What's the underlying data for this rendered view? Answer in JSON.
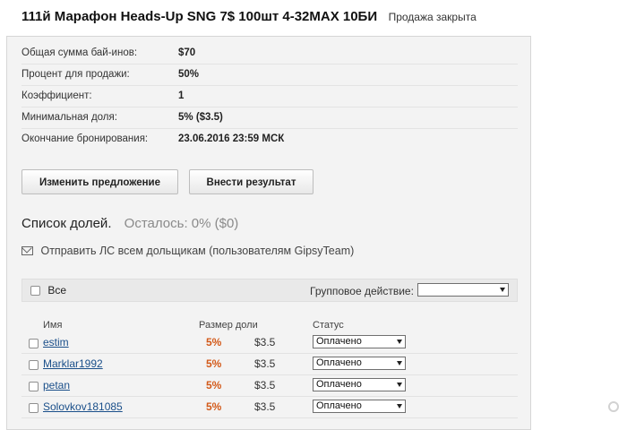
{
  "header": {
    "title": "111й Марафон Heads-Up SNG 7$ 100шт 4-32MAX 10БИ",
    "status": "Продажа закрыта"
  },
  "info": [
    {
      "label": "Общая сумма бай-инов:",
      "value": "$70"
    },
    {
      "label": "Процент для продажи:",
      "value": "50%"
    },
    {
      "label": "Коэффициент:",
      "value": "1"
    },
    {
      "label": "Минимальная доля:",
      "value": "5% ($3.5)"
    },
    {
      "label": "Окончание бронирования:",
      "value": "23.06.2016 23:59 МСК"
    }
  ],
  "buttons": {
    "edit_offer": "Изменить предложение",
    "enter_result": "Внести результат"
  },
  "shares": {
    "title": "Список долей.",
    "remaining": "Осталось: 0% ($0)",
    "send_message": "Отправить ЛС всем дольщикам (пользователям GipsyTeam)",
    "select_all": "Все",
    "group_action_label": "Групповое действие:",
    "group_action_value": ""
  },
  "columns": {
    "name": "Имя",
    "share_size": "Размер доли",
    "status": "Статус"
  },
  "rows": [
    {
      "name": "estim",
      "percent": "5%",
      "amount": "$3.5",
      "status": "Оплачено"
    },
    {
      "name": "Marklar1992",
      "percent": "5%",
      "amount": "$3.5",
      "status": "Оплачено"
    },
    {
      "name": "petan",
      "percent": "5%",
      "amount": "$3.5",
      "status": "Оплачено"
    },
    {
      "name": "Solovkov181085",
      "percent": "5%",
      "amount": "$3.5",
      "status": "Оплачено"
    }
  ],
  "icons": {
    "mail": "mail-icon",
    "dropdown": "chevron-down-icon"
  },
  "colors": {
    "accent_percent": "#d35a1a",
    "link": "#1a4f8a",
    "panel_bg": "#f3f3f3"
  }
}
